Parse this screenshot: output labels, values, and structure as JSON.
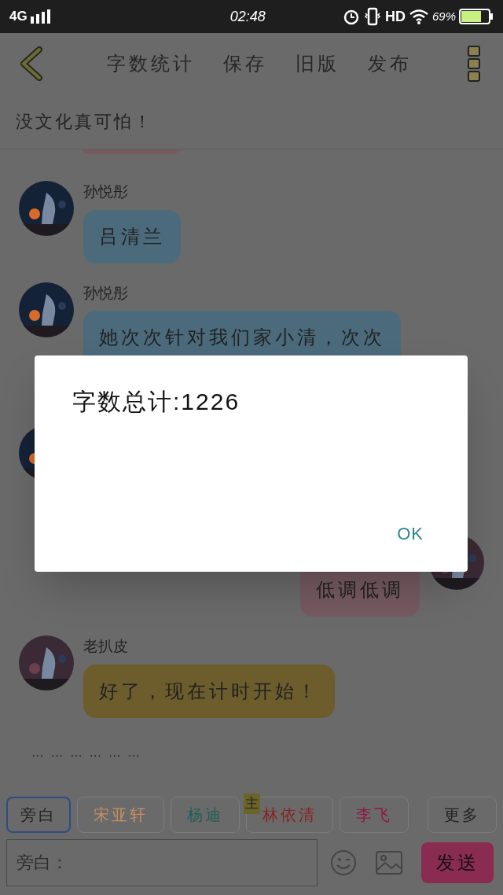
{
  "status_bar": {
    "network": "4G",
    "time": "02:48",
    "hd": "HD",
    "battery": "69%"
  },
  "toolbar": {
    "actions": [
      "字数统计",
      "保存",
      "旧版",
      "发布"
    ]
  },
  "title": "没文化真可怕！",
  "messages": [
    {
      "kind": "partial"
    },
    {
      "kind": "incoming",
      "sender": "孙悦彤",
      "text": "吕清兰",
      "color": "#4b6a7c"
    },
    {
      "kind": "incoming",
      "sender": "孙悦彤",
      "text": "她次次针对我们家小清，次次",
      "color": "#4b6a7c"
    },
    {
      "kind": "avatar"
    },
    {
      "kind": "outgoing",
      "text": "低调低调",
      "color": "#755a60"
    },
    {
      "kind": "incoming",
      "sender": "老扒皮",
      "text": "好了，现在计时开始！",
      "color": "#6d5c2c"
    }
  ],
  "ellipsis": "… … … … … …",
  "roles": [
    {
      "label": "旁白",
      "color": "#222222",
      "selected": true
    },
    {
      "label": "宋亚轩",
      "color": "#c89060",
      "selected": false
    },
    {
      "label": "杨迪",
      "color": "#1e5e58",
      "selected": false
    },
    {
      "label": "林依清",
      "color": "#8a2020",
      "selected": false,
      "badge": "主"
    },
    {
      "label": "李飞",
      "color": "#8e1848",
      "selected": false
    },
    {
      "label": "更多",
      "color": "#222222",
      "selected": false
    }
  ],
  "input": {
    "placeholder": "旁白："
  },
  "send_button": "发送",
  "dialog": {
    "text": "字数总计:1226",
    "button": "OK"
  }
}
